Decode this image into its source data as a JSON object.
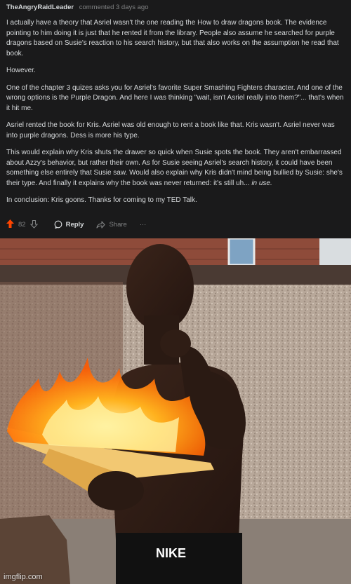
{
  "comment": {
    "author": "TheAngryRaidLeader",
    "time": "commented 3 days ago",
    "paragraphs": [
      "I actually have a theory that Asriel wasn't the one reading the How to draw dragons book. The evidence pointing to him doing it is just that he rented it from the library. People also assume he searched for purple dragons based on Susie's reaction to his search history, but that also works on the assumption he read that book.",
      "However.",
      "One of the chapter 3 quizes asks you for Asriel's favorite Super Smashing Fighters character. And one of the wrong options is the Purple Dragon. And here I was thinking \"wait, isn't Asriel really into them?\"... that's when it hit me.",
      "Asriel rented the book for Kris. Asriel was old enough to rent a book like that. Kris wasn't. Asriel never was into purple dragons. Dess is more his type.",
      "This would explain why Kris shuts the drawer so quick when Susie spots the book. They aren't embarrassed about Azzy's behavior, but rather their own. As for Susie seeing Asriel's search history, it could have been something else entirely that Susie saw. Would also explain why Kris didn't mind being bullied by Susie: she's their type. And finally it explains why the book was never returned: it's still uh...",
      "In conclusion: Kris goons. Thanks for coming to my TED Talk."
    ],
    "emphasis": "in use.",
    "score": "82",
    "reply_label": "Reply",
    "share_label": "Share",
    "more_label": "···",
    "upvote_color": "#ff4500"
  },
  "photo": {
    "watermark": "imgflip.com",
    "shorts_brand": "NIKE"
  }
}
